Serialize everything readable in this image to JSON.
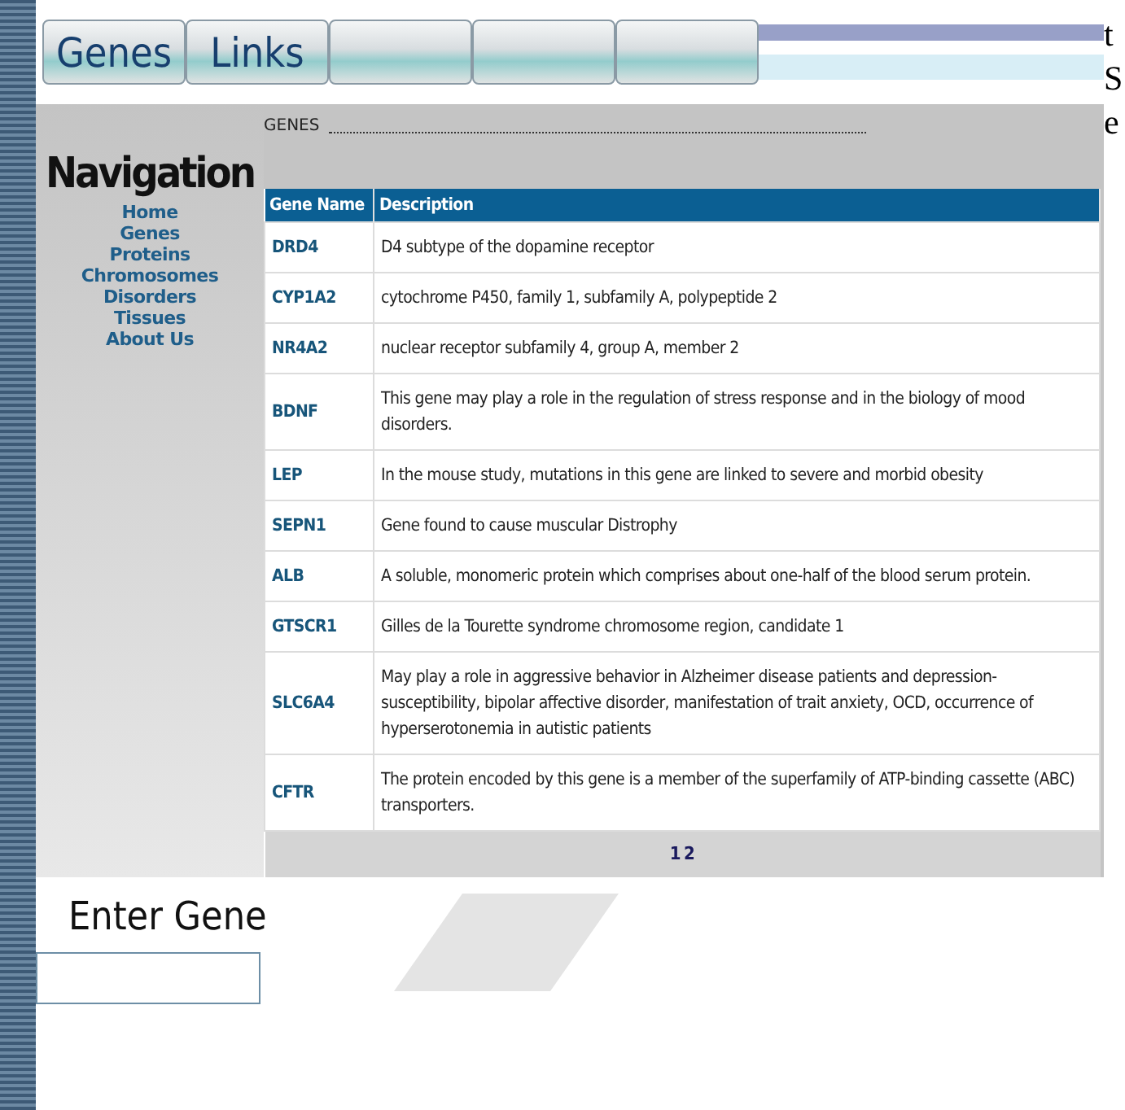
{
  "header_tabs": [
    {
      "label": "Genes"
    },
    {
      "label": "Links"
    }
  ],
  "navigation": {
    "title": "Navigation",
    "items": [
      "Home",
      "Genes",
      "Proteins",
      "Chromosomes",
      "Disorders",
      "Tissues",
      "About Us"
    ]
  },
  "section_title": "GENES",
  "table": {
    "columns": [
      "Gene Name",
      "Description"
    ],
    "rows": [
      {
        "name": "DRD4",
        "description": "D4 subtype of the dopamine receptor"
      },
      {
        "name": "CYP1A2",
        "description": "cytochrome P450, family 1, subfamily A, polypeptide 2"
      },
      {
        "name": "NR4A2",
        "description": "nuclear receptor subfamily 4, group A, member 2"
      },
      {
        "name": "BDNF",
        "description": "This gene may play a role in the regulation of stress response and in the biology of mood disorders."
      },
      {
        "name": "LEP",
        "description": "In the mouse study, mutations in this gene are linked to severe and morbid obesity"
      },
      {
        "name": "SEPN1",
        "description": "Gene found to cause muscular Distrophy"
      },
      {
        "name": "ALB",
        "description": "A soluble, monomeric protein which comprises about one-half of the blood serum protein."
      },
      {
        "name": "GTSCR1",
        "description": "Gilles de la Tourette syndrome chromosome region, candidate 1"
      },
      {
        "name": "SLC6A4",
        "description": "May play a role in aggressive behavior in Alzheimer disease patients and depression-susceptibility, bipolar affective disorder, manifestation of trait anxiety, OCD, occurrence of hyperserotonemia in autistic patients"
      },
      {
        "name": "CFTR",
        "description": "The protein encoded by this gene is a member of the superfamily of ATP-binding cassette (ABC) transporters."
      }
    ],
    "pages": [
      "1",
      "2"
    ]
  },
  "gene_search": {
    "label": "Enter Gene"
  },
  "side_text": [
    "t",
    "S",
    "e"
  ]
}
